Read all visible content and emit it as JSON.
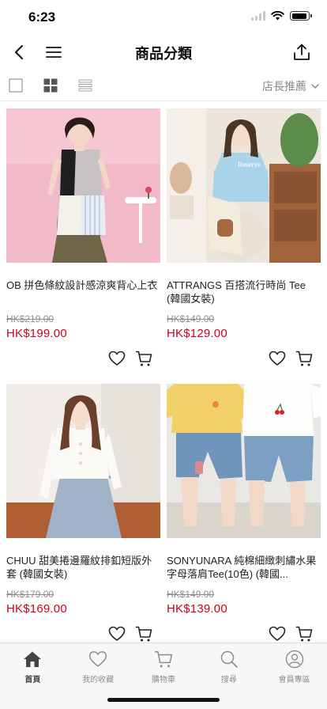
{
  "status_bar": {
    "time": "6:23",
    "battery_level": 0.9
  },
  "navbar": {
    "title": "商品分類",
    "back_icon": "chevron-left-icon",
    "menu_icon": "hamburger-menu-icon",
    "share_icon": "share-icon"
  },
  "toolbar": {
    "views": [
      "list-view-icon",
      "grid-view-icon",
      "compact-list-view-icon"
    ],
    "active_view": "grid-view-icon",
    "sort_label": "店長推薦"
  },
  "products": [
    {
      "name": "OB 拼色條紋設計感涼爽背心上衣",
      "original_price": "HK$219.00",
      "sale_price": "HK$199.00"
    },
    {
      "name": "ATTRANGS 百搭流行時尚 Tee (韓國女裝)",
      "original_price": "HK$149.00",
      "sale_price": "HK$129.00"
    },
    {
      "name": "CHUU 甜美捲邊羅紋排釦短版外套 (韓國女裝)",
      "original_price": "HK$179.00",
      "sale_price": "HK$169.00"
    },
    {
      "name": "SONYUNARA 純棉細緻刺繡水果字母落肩Tee(10色) (韓國...",
      "original_price": "HK$149.00",
      "sale_price": "HK$139.00"
    }
  ],
  "tabbar": {
    "items": [
      {
        "label": "首頁",
        "icon": "home-icon",
        "active": true
      },
      {
        "label": "我的收藏",
        "icon": "heart-icon",
        "active": false
      },
      {
        "label": "購物車",
        "icon": "cart-icon",
        "active": false
      },
      {
        "label": "搜尋",
        "icon": "search-icon",
        "active": false
      },
      {
        "label": "會員專區",
        "icon": "user-icon",
        "active": false
      }
    ]
  },
  "colors": {
    "sale_price": "#d0021b",
    "original_price": "#8d8d8d",
    "tab_inactive": "#8e8e8e",
    "tab_active": "#444444"
  }
}
